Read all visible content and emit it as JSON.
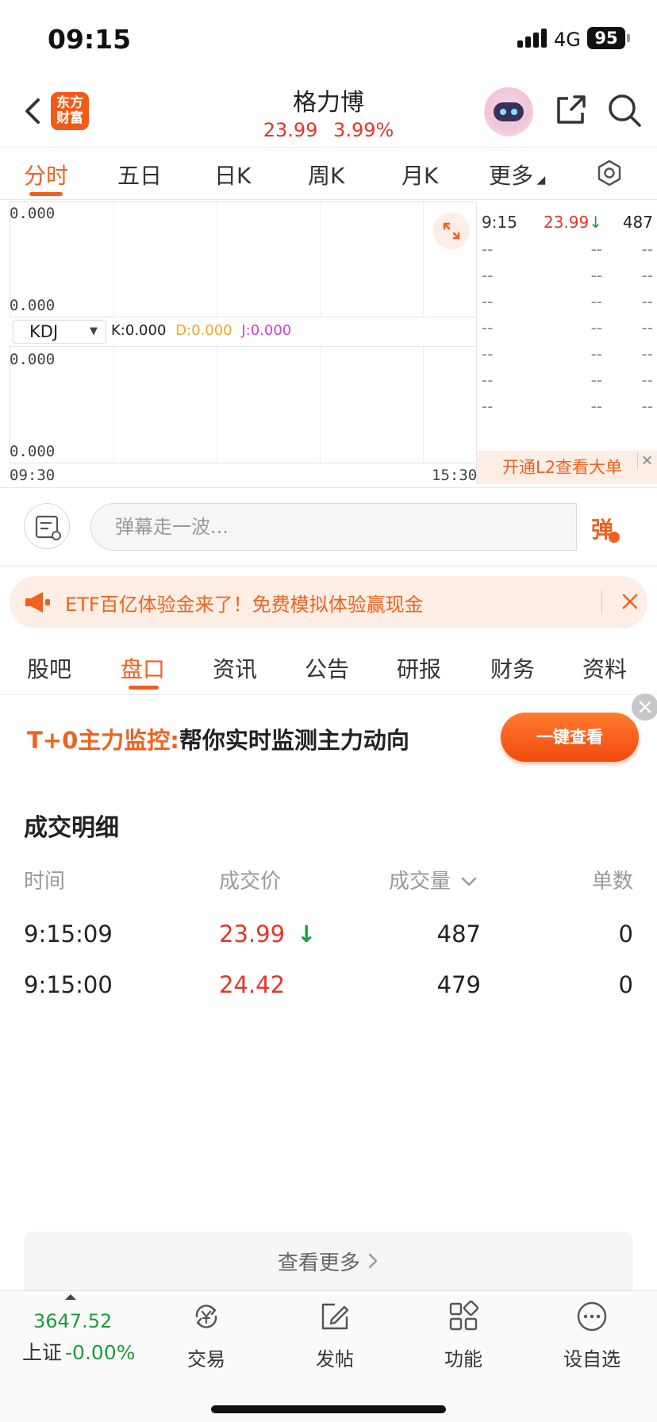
{
  "status_bar": {
    "time": "09:15",
    "network": "4G",
    "battery": "95"
  },
  "header": {
    "logo_line1": "东方",
    "logo_line2": "财富",
    "stock_name": "格力博",
    "price": "23.99",
    "change_pct": "3.99%"
  },
  "chart_tabs": [
    {
      "label": "分时"
    },
    {
      "label": "五日"
    },
    {
      "label": "日K"
    },
    {
      "label": "周K"
    },
    {
      "label": "月K"
    },
    {
      "label": "更多"
    }
  ],
  "chart": {
    "upper_max": "0.000",
    "upper_min": "0.000",
    "lower_max": "0.000",
    "lower_min": "0.000",
    "time_start": "09:30",
    "time_end": "15:30",
    "indicator": "KDJ",
    "k_value": "K:0.000",
    "d_value": "D:0.000",
    "j_value": "J:0.000",
    "colors": {
      "k": "#222222",
      "d": "#f5a623",
      "j": "#d63ad6"
    }
  },
  "tick_panel": {
    "first": {
      "time": "9:15",
      "price": "23.99",
      "arrow": "↓",
      "volume": "487"
    },
    "placeholder_rows": [
      [
        "--",
        "--",
        "--"
      ],
      [
        "--",
        "--",
        "--"
      ],
      [
        "--",
        "--",
        "--"
      ],
      [
        "--",
        "--",
        "--"
      ],
      [
        "--",
        "--",
        "--"
      ],
      [
        "--",
        "--",
        "--"
      ],
      [
        "--",
        "--",
        "--"
      ]
    ],
    "l2_banner": "开通L2查看大单"
  },
  "barrage": {
    "placeholder": "弹幕走一波...",
    "send_label": "弹"
  },
  "notice": {
    "text": "ETF百亿体验金来了！免费模拟体验赢现金"
  },
  "section_tabs": [
    {
      "label": "股吧"
    },
    {
      "label": "盘口"
    },
    {
      "label": "资讯"
    },
    {
      "label": "公告"
    },
    {
      "label": "研报"
    },
    {
      "label": "财务"
    },
    {
      "label": "资料"
    }
  ],
  "promo": {
    "title_highlight": "T+0主力监控:",
    "title_rest": "帮你实时监测主力动向",
    "button": "一键查看"
  },
  "deals": {
    "title": "成交明细",
    "headers": {
      "time": "时间",
      "price": "成交价",
      "volume": "成交量",
      "count": "单数"
    },
    "rows": [
      {
        "time": "9:15:09",
        "price": "23.99",
        "arrow": "↓",
        "volume": "487",
        "count": "0"
      },
      {
        "time": "9:15:00",
        "price": "24.42",
        "arrow": "",
        "volume": "479",
        "count": "0"
      }
    ],
    "more": "查看更多"
  },
  "bottom_nav": {
    "index_value": "3647.52",
    "index_name": "上证",
    "index_change": "-0.00%",
    "items": [
      {
        "label": "交易"
      },
      {
        "label": "发帖"
      },
      {
        "label": "功能"
      },
      {
        "label": "设自选"
      }
    ]
  },
  "colors": {
    "accent": "#f0611e",
    "up": "#e6352b",
    "down": "#1a9e3a"
  }
}
